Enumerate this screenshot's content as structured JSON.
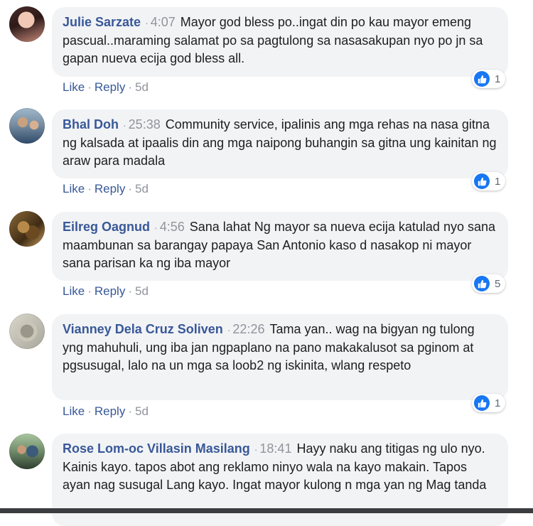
{
  "colors": {
    "link": "#385898",
    "bubble_bg": "#f2f3f5",
    "meta": "#90949c",
    "like_blue": "#1877f2"
  },
  "actions": {
    "like": "Like",
    "reply": "Reply",
    "separator": "·"
  },
  "comments": [
    {
      "author": "Julie Sarzate",
      "time": "4:07",
      "text": "Mayor god bless po..ingat din po kau mayor emeng pascual..maraming salamat po sa pagtulong sa nasasakupan nyo po jn sa gapan nueva ecija god bless all.",
      "age": "5d",
      "reactions": "1",
      "reaction_icon": "like-icon"
    },
    {
      "author": "Bhal Doh",
      "time": "25:38",
      "text": "Community service, ipalinis ang mga rehas na nasa gitna ng kalsada at ipaalis din ang mga naipong buhangin sa gitna ung kainitan ng araw para madala",
      "age": "5d",
      "reactions": "1",
      "reaction_icon": "like-icon"
    },
    {
      "author": "Eilreg Oagnud",
      "time": "4:56",
      "text": "Sana lahat Ng mayor sa nueva ecija katulad nyo sana maambunan sa barangay papaya San Antonio kaso d nasakop ni mayor sana parisan ka ng iba mayor",
      "age": "5d",
      "reactions": "5",
      "reaction_icon": "like-icon"
    },
    {
      "author": "Vianney Dela Cruz Soliven",
      "time": "22:26",
      "text": "Tama yan.. wag na bigyan ng tulong yng mahuhuli, ung iba jan ngpaplano na pano makakalusot sa pginom at pgsusugal, lalo na un mga sa loob2 ng iskinita, wlang respeto",
      "age": "5d",
      "reactions": "1",
      "reaction_icon": "like-icon"
    },
    {
      "author": "Rose Lom-oc Villasin Masilang",
      "time": "18:41",
      "text": "Hayy naku ang titigas ng ulo nyo. Kainis kayo. tapos abot ang reklamo ninyo wala na kayo makain. Tapos ayan nag susugal Lang kayo. Ingat mayor kulong n mga yan ng Mag tanda"
    }
  ]
}
